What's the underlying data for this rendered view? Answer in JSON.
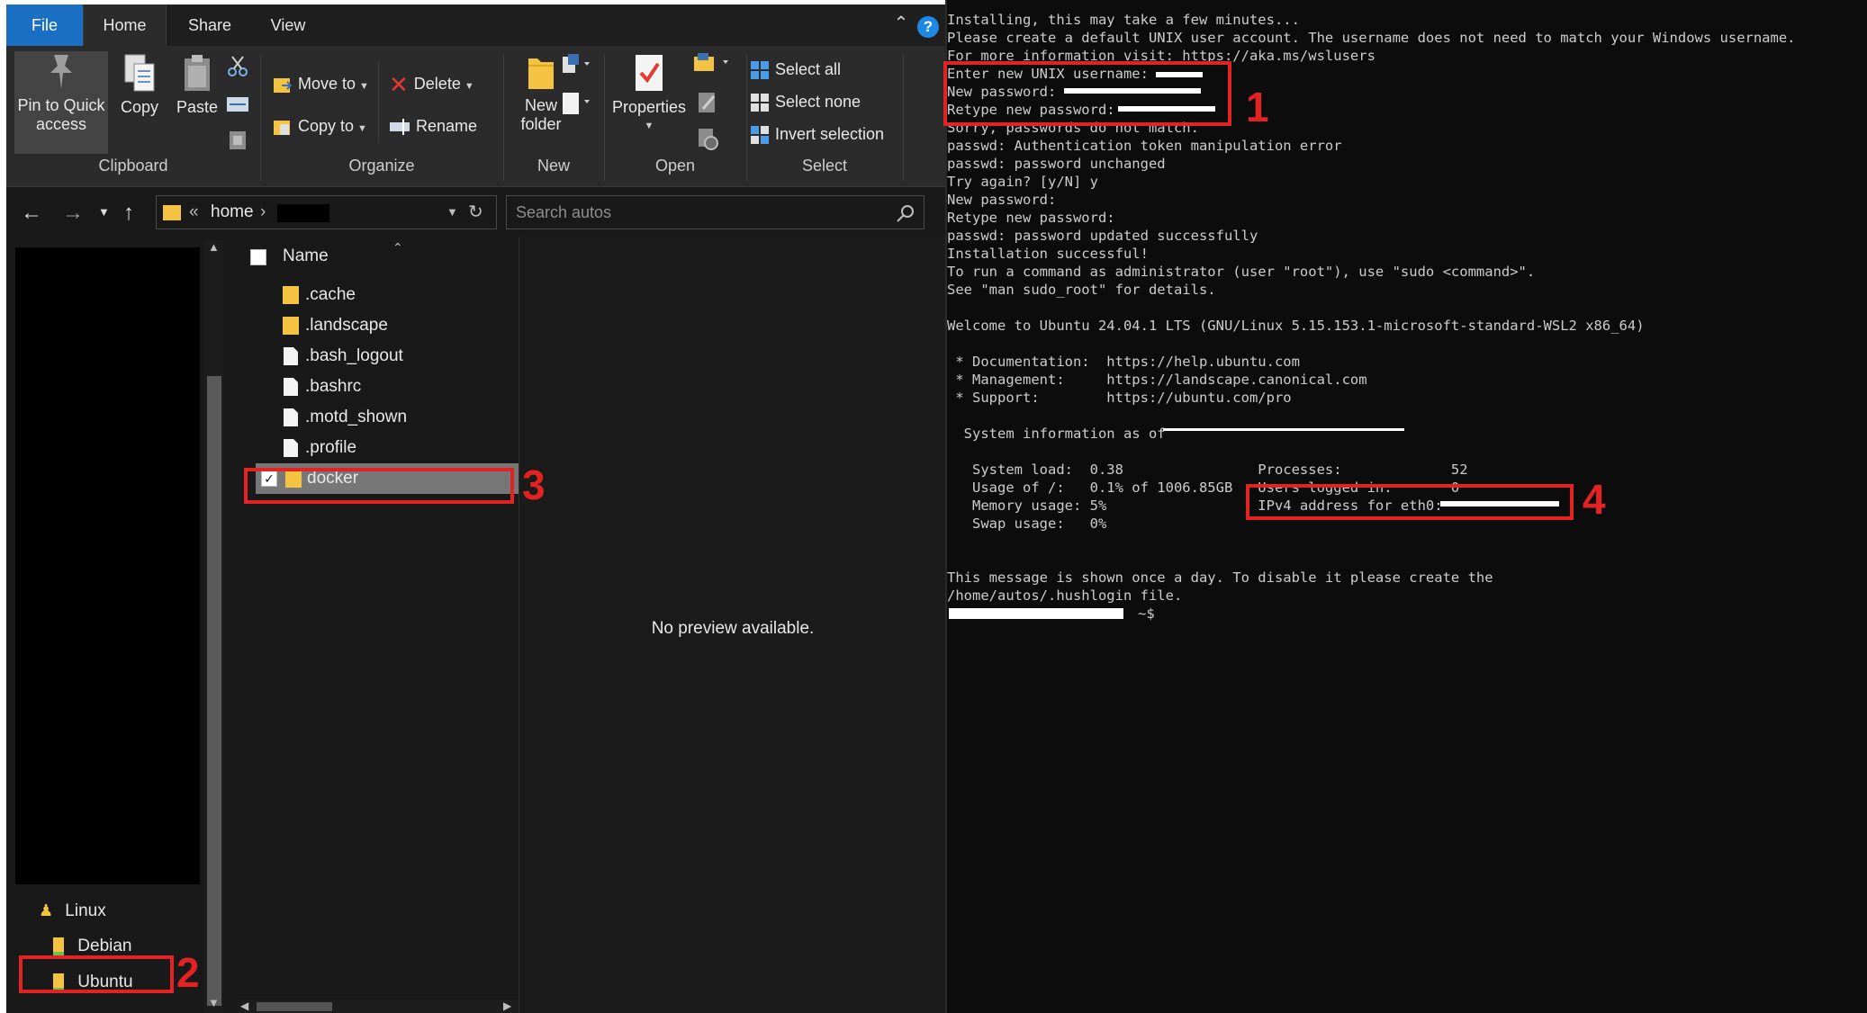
{
  "explorer": {
    "tabs": [
      "File",
      "Home",
      "Share",
      "View"
    ],
    "ribbon": {
      "clipboard": {
        "group_label": "Clipboard",
        "pin_label": "Pin to Quick access",
        "copy_label": "Copy",
        "paste_label": "Paste"
      },
      "organize": {
        "group_label": "Organize",
        "move_to_label": "Move to",
        "copy_to_label": "Copy to",
        "delete_label": "Delete",
        "rename_label": "Rename"
      },
      "new": {
        "group_label": "New",
        "new_folder_label": "New folder"
      },
      "open": {
        "group_label": "Open",
        "properties_label": "Properties"
      },
      "select": {
        "group_label": "Select",
        "select_all_label": "Select all",
        "select_none_label": "Select none",
        "invert_label": "Invert selection"
      }
    },
    "address": {
      "chevrons": "«",
      "home": "home",
      "separator": "›"
    },
    "search": {
      "placeholder": "Search autos"
    },
    "nav_pane": {
      "linux": "Linux",
      "debian": "Debian",
      "ubuntu": "Ubuntu"
    },
    "file_list": {
      "column_name": "Name",
      "items": [
        {
          "name": ".cache",
          "type": "folder"
        },
        {
          "name": ".landscape",
          "type": "folder"
        },
        {
          "name": ".bash_logout",
          "type": "file"
        },
        {
          "name": ".bashrc",
          "type": "file"
        },
        {
          "name": ".motd_shown",
          "type": "file"
        },
        {
          "name": ".profile",
          "type": "file"
        },
        {
          "name": "docker",
          "type": "folder",
          "selected": true
        }
      ]
    },
    "preview": {
      "message": "No preview available."
    }
  },
  "terminal": {
    "lines": [
      "Installing, this may take a few minutes...",
      "Please create a default UNIX user account. The username does not need to match your Windows username.",
      "For more information visit: https://aka.ms/wslusers",
      "Enter new UNIX username:",
      "New password:",
      "Retype new password:",
      "Sorry, passwords do not match.",
      "passwd: Authentication token manipulation error",
      "passwd: password unchanged",
      "Try again? [y/N] y",
      "New password:",
      "Retype new password:",
      "passwd: password updated successfully",
      "Installation successful!",
      "To run a command as administrator (user \"root\"), use \"sudo <command>\".",
      "See \"man sudo_root\" for details.",
      "",
      "Welcome to Ubuntu 24.04.1 LTS (GNU/Linux 5.15.153.1-microsoft-standard-WSL2 x86_64)",
      "",
      " * Documentation:  https://help.ubuntu.com",
      " * Management:     https://landscape.canonical.com",
      " * Support:        https://ubuntu.com/pro",
      "",
      "  System information as of",
      "",
      "   System load:  0.38                Processes:             52",
      "   Usage of /:   0.1% of 1006.85GB   Users logged in:       0",
      "   Memory usage: 5%                  IPv4 address for eth0:",
      "   Swap usage:   0%",
      "",
      "",
      "This message is shown once a day. To disable it please create the",
      "/home/autos/.hushlogin file."
    ],
    "prompt_suffix": "~$"
  },
  "annotations": [
    "1",
    "2",
    "3",
    "4"
  ],
  "colors": {
    "annotation_red": "#e52222",
    "file_tab_blue": "#1a6fc4",
    "folder_yellow": "#f5c342",
    "terminal_bg": "#0c0c0c"
  }
}
